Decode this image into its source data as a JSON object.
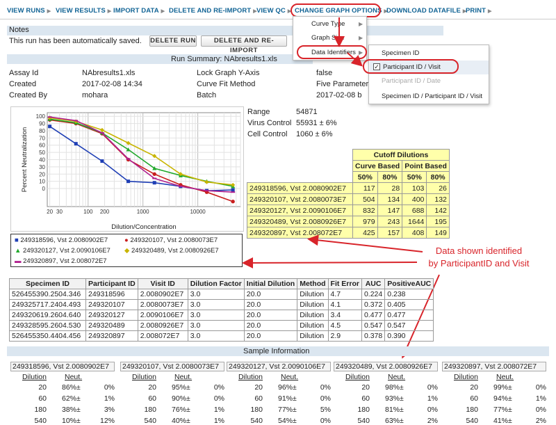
{
  "menu": [
    "VIEW RUNS",
    "VIEW RESULTS",
    "IMPORT DATA",
    "DELETE AND RE-IMPORT",
    "VIEW QC",
    "CHANGE GRAPH OPTIONS",
    "DOWNLOAD DATAFILE",
    "PRINT"
  ],
  "graph_options_menu": [
    "Curve Type",
    "Graph Size",
    "Data Identifiers"
  ],
  "data_identifiers_menu": [
    "Specimen ID",
    "Participant ID / Visit",
    "Participant ID / Date",
    "Specimen ID / Participant ID / Visit"
  ],
  "notes": {
    "title": "Notes",
    "message": "This run has been automatically saved.",
    "delete_run": "DELETE RUN",
    "delete_reimport": "DELETE AND RE-IMPORT"
  },
  "run_summary": {
    "title": "Run Summary: NAbresults1.xls",
    "fields": [
      {
        "label": "Assay Id",
        "value": "NAbresults1.xls"
      },
      {
        "label": "Created",
        "value": "2017-02-08 14:34"
      },
      {
        "label": "Created By",
        "value": "mohara"
      },
      {
        "label": "Lock Graph Y-Axis",
        "value": "false"
      },
      {
        "label": "Curve Fit Method",
        "value": "Five Parameter"
      },
      {
        "label": "Batch",
        "value": "2017-02-08 b"
      }
    ]
  },
  "controls": [
    {
      "label": "Range",
      "value": "54871"
    },
    {
      "label": "Virus Control",
      "value": "55931 ± 6%"
    },
    {
      "label": "Cell Control",
      "value": "1060 ± 6%"
    }
  ],
  "chart_data": {
    "type": "line",
    "xlabel": "Dilution/Concentration",
    "ylabel": "Percent Neutralization",
    "x_scale": "log",
    "x_ticks": [
      "20",
      "30",
      "100",
      "200",
      "1000",
      "10000"
    ],
    "y_ticks": [
      "0",
      "10",
      "20",
      "30",
      "40",
      "50",
      "60",
      "70",
      "80",
      "90",
      "100"
    ],
    "xlim": [
      18,
      60000
    ],
    "ylim": [
      -25,
      105
    ],
    "grid": true,
    "series": [
      {
        "name": "249318596, Vst 2.0080902E7",
        "color": "#1f3fb5",
        "marker": "square",
        "x": [
          20,
          60,
          180,
          540,
          1620,
          4860,
          14580,
          43740
        ],
        "y": [
          86,
          62,
          38,
          10,
          8,
          3,
          -3,
          -2
        ]
      },
      {
        "name": "249320107, Vst 2.0080073E7",
        "color": "#c81e1e",
        "marker": "circle",
        "x": [
          20,
          60,
          180,
          540,
          1620,
          4860,
          14580,
          43740
        ],
        "y": [
          95,
          90,
          76,
          40,
          20,
          5,
          -5,
          -18
        ]
      },
      {
        "name": "249320127, Vst 2.0090106E7",
        "color": "#1fa82a",
        "marker": "triangle",
        "x": [
          20,
          60,
          180,
          540,
          1620,
          4860,
          14580,
          43740
        ],
        "y": [
          96,
          91,
          77,
          54,
          28,
          18,
          10,
          3
        ]
      },
      {
        "name": "249320489, Vst 2.0080926E7",
        "color": "#c8b400",
        "marker": "diamond",
        "x": [
          20,
          60,
          180,
          540,
          1620,
          4860,
          14580,
          43740
        ],
        "y": [
          98,
          93,
          81,
          63,
          45,
          20,
          9,
          5
        ]
      },
      {
        "name": "249320897, Vst 2.008072E7",
        "color": "#b0208f",
        "marker": "line",
        "x": [
          20,
          60,
          180,
          540,
          1620,
          4860,
          14580,
          43740
        ],
        "y": [
          99,
          94,
          77,
          41,
          14,
          3,
          -3,
          -5
        ]
      }
    ]
  },
  "cutoff": {
    "title": "Cutoff Dilutions",
    "curve_based": "Curve Based",
    "point_based": "Point Based",
    "p50": "50%",
    "p80": "80%",
    "rows": [
      {
        "id": "249318596, Vst 2.0080902E7",
        "c50": "117",
        "c80": "28",
        "p50": "103",
        "p80": "26"
      },
      {
        "id": "249320107, Vst 2.0080073E7",
        "c50": "504",
        "c80": "134",
        "p50": "400",
        "p80": "132"
      },
      {
        "id": "249320127, Vst 2.0090106E7",
        "c50": "832",
        "c80": "147",
        "p50": "688",
        "p80": "142"
      },
      {
        "id": "249320489, Vst 2.0080926E7",
        "c50": "979",
        "c80": "243",
        "p50": "1644",
        "p80": "195"
      },
      {
        "id": "249320897, Vst 2.008072E7",
        "c50": "425",
        "c80": "157",
        "p50": "408",
        "p80": "149"
      }
    ]
  },
  "legend": [
    "249318596, Vst 2.0080902E7",
    "249320107, Vst 2.0080073E7",
    "249320127, Vst 2.0090106E7",
    "249320489, Vst 2.0080926E7",
    "249320897, Vst 2.008072E7"
  ],
  "annotation": "Data shown identified\nby ParticipantID and Visit",
  "specimen_table": {
    "headers": [
      "Specimen ID",
      "Participant ID",
      "Visit ID",
      "Dilution Factor",
      "Initial Dilution",
      "Method",
      "Fit Error",
      "AUC",
      "PositiveAUC"
    ],
    "rows": [
      [
        "526455390.2504.346",
        "249318596",
        "2.0080902E7",
        "3.0",
        "20.0",
        "Dilution",
        "4.7",
        "0.224",
        "0.238"
      ],
      [
        "249325717.2404.493",
        "249320107",
        "2.0080073E7",
        "3.0",
        "20.0",
        "Dilution",
        "4.1",
        "0.372",
        "0.405"
      ],
      [
        "249320619.2604.640",
        "249320127",
        "2.0090106E7",
        "3.0",
        "20.0",
        "Dilution",
        "3.4",
        "0.477",
        "0.477"
      ],
      [
        "249328595.2604.530",
        "249320489",
        "2.0080926E7",
        "3.0",
        "20.0",
        "Dilution",
        "4.5",
        "0.547",
        "0.547"
      ],
      [
        "526455350.4404.456",
        "249320897",
        "2.008072E7",
        "3.0",
        "20.0",
        "Dilution",
        "2.9",
        "0.378",
        "0.390"
      ]
    ]
  },
  "sample_info": {
    "title": "Sample Information",
    "dilution_label": "Dilution",
    "neut_label": "Neut.",
    "groups": [
      {
        "id": "249318596, Vst 2.0080902E7",
        "rows": [
          [
            "20",
            "86%",
            "±",
            "0%"
          ],
          [
            "60",
            "62%",
            "±",
            "1%"
          ],
          [
            "180",
            "38%",
            "±",
            "3%"
          ],
          [
            "540",
            "10%",
            "±",
            "12%"
          ]
        ]
      },
      {
        "id": "249320107, Vst 2.0080073E7",
        "rows": [
          [
            "20",
            "95%",
            "±",
            "0%"
          ],
          [
            "60",
            "90%",
            "±",
            "0%"
          ],
          [
            "180",
            "76%",
            "±",
            "1%"
          ],
          [
            "540",
            "40%",
            "±",
            "1%"
          ]
        ]
      },
      {
        "id": "249320127, Vst 2.0090106E7",
        "rows": [
          [
            "20",
            "96%",
            "±",
            "0%"
          ],
          [
            "60",
            "91%",
            "±",
            "0%"
          ],
          [
            "180",
            "77%",
            "±",
            "5%"
          ],
          [
            "540",
            "54%",
            "±",
            "0%"
          ]
        ]
      },
      {
        "id": "249320489, Vst 2.0080926E7",
        "rows": [
          [
            "20",
            "98%",
            "±",
            "0%"
          ],
          [
            "60",
            "93%",
            "±",
            "1%"
          ],
          [
            "180",
            "81%",
            "±",
            "0%"
          ],
          [
            "540",
            "63%",
            "±",
            "2%"
          ]
        ]
      },
      {
        "id": "249320897, Vst 2.008072E7",
        "rows": [
          [
            "20",
            "99%",
            "±",
            "0%"
          ],
          [
            "60",
            "94%",
            "±",
            "1%"
          ],
          [
            "180",
            "77%",
            "±",
            "0%"
          ],
          [
            "540",
            "41%",
            "±",
            "2%"
          ]
        ]
      }
    ]
  }
}
